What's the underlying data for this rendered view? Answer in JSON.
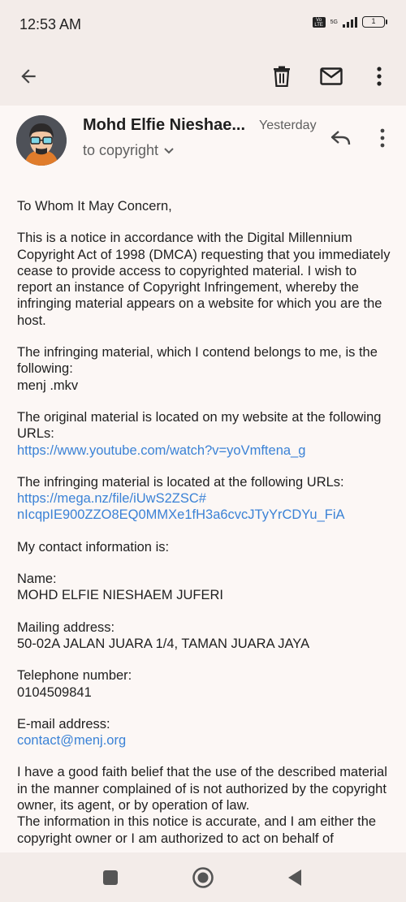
{
  "status_bar": {
    "time": "12:53 AM",
    "volte": "Vo LTE",
    "network": "5G",
    "battery": "1"
  },
  "toolbar": {
    "back_icon": "arrow-left-icon",
    "delete_icon": "trash-icon",
    "mail_icon": "mail-icon",
    "more_icon": "more-vertical-icon"
  },
  "email": {
    "sender": "Mohd Elfie Nieshae...",
    "date": "Yesterday",
    "recipient": "to copyright",
    "greeting": "To Whom It May Concern,",
    "p1": "This is a notice in accordance with the Digital Millennium Copyright Act of 1998 (DMCA) requesting that you immediately cease to provide access to copyrighted material. I wish to report an instance of Copyright Infringement, whereby the infringing material appears on a website for which you are the host.",
    "p2_text": "The infringing material, which I contend belongs to me, is the following:",
    "p2_file": "menj .mkv",
    "p3_text": "The original material is located on my website at the following URLs:",
    "p3_link": "https://www.youtube.com/watch?v=yoVmftena_g",
    "p4_text": "The infringing material is located at the following URLs:",
    "p4_link_line1": "https://mega.nz/file/iUwS2ZSC#",
    "p4_link_line2": "nIcqpIE900ZZO8EQ0MMXe1fH3a6cvcJTyYrCDYu_FiA",
    "p5": "My contact information is:",
    "name_label": "Name:",
    "name_value": "MOHD ELFIE NIESHAEM JUFERI",
    "mail_label": "Mailing address:",
    "mail_value": "50-02A JALAN JUARA 1/4, TAMAN JUARA JAYA",
    "tel_label": "Telephone number:",
    "tel_value": "0104509841",
    "email_label": "E-mail address:",
    "email_value": "contact@menj.org",
    "p_faith": "I have a good faith belief that the use of the described material in the manner complained of is not authorized by the copyright owner, its agent, or by operation of law.",
    "p_accurate": "The information in this notice is accurate, and I am either the copyright owner or I am authorized to act on behalf of"
  },
  "colors": {
    "bar_bg": "#f3ece9",
    "body_bg": "#fcf7f5",
    "link": "#3b82d6",
    "text": "#1f1f1f",
    "muted": "#5f5f5f"
  }
}
